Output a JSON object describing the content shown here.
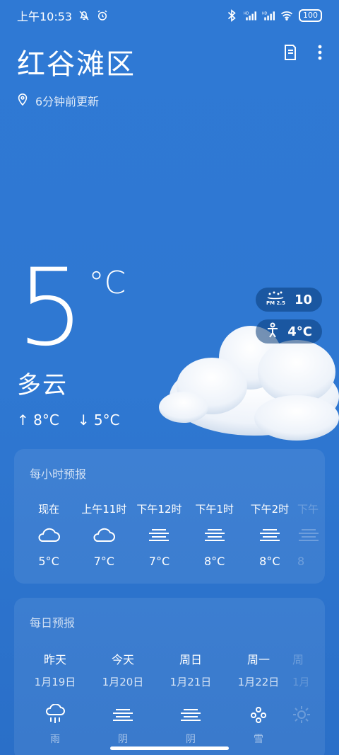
{
  "status": {
    "time": "上午10:53",
    "battery": "100"
  },
  "header": {
    "city": "红谷滩区",
    "updated": "6分钟前更新"
  },
  "current": {
    "temp": "5",
    "unit": "°C",
    "condition": "多云",
    "high": "↑ 8°C",
    "low": "↓ 5°C"
  },
  "badges": {
    "pm25_label": "PM 2.5",
    "pm25_value": "10",
    "feels_like": "4°C"
  },
  "hourly": {
    "title": "每小时预报",
    "items": [
      {
        "time": "现在",
        "temp": "5°C",
        "icon": "cloudy-icon"
      },
      {
        "time": "上午11时",
        "temp": "7°C",
        "icon": "cloudy-icon"
      },
      {
        "time": "下午12时",
        "temp": "7°C",
        "icon": "overcast-icon"
      },
      {
        "time": "下午1时",
        "temp": "8°C",
        "icon": "overcast-icon"
      },
      {
        "time": "下午2时",
        "temp": "8°C",
        "icon": "overcast-icon"
      },
      {
        "time": "下午",
        "temp": "8",
        "icon": "overcast-icon"
      }
    ]
  },
  "daily": {
    "title": "每日预报",
    "items": [
      {
        "day": "昨天",
        "date": "1月19日",
        "cond": "雨",
        "icon": "rain-icon"
      },
      {
        "day": "今天",
        "date": "1月20日",
        "cond": "阴",
        "icon": "overcast-icon"
      },
      {
        "day": "周日",
        "date": "1月21日",
        "cond": "阴",
        "icon": "overcast-icon"
      },
      {
        "day": "周一",
        "date": "1月22日",
        "cond": "雪",
        "icon": "snow-icon"
      },
      {
        "day": "周",
        "date": "1月",
        "cond": "",
        "icon": "sun-icon"
      }
    ]
  },
  "colors": {
    "background": "#2f79d4",
    "card": "rgba(255,255,255,0.08)",
    "badge": "#0a3c78"
  }
}
